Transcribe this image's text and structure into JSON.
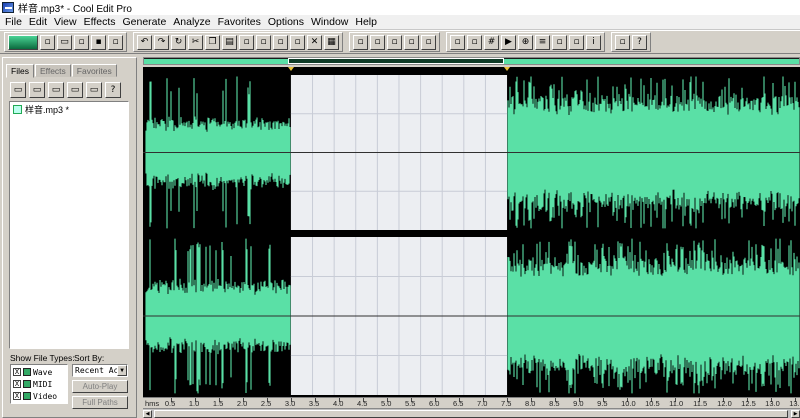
{
  "window": {
    "title": "样音.mp3* - Cool Edit Pro"
  },
  "menu": [
    "File",
    "Edit",
    "View",
    "Effects",
    "Generate",
    "Analyze",
    "Favorites",
    "Options",
    "Window",
    "Help"
  ],
  "toolbar_groups": [
    [
      "wave-view-icon",
      "new-icon",
      "open-icon",
      "close-icon",
      "save-icon",
      "save-all-icon"
    ],
    [
      "undo-icon",
      "redo-icon",
      "repeat-icon",
      "cut-icon",
      "copy-icon",
      "paste-icon",
      "paste-new-icon",
      "mix-paste-icon",
      "trim-icon",
      "silence-icon",
      "delete-icon",
      "select-all-icon"
    ],
    [
      "invert-icon",
      "filter-icon",
      "spectral-icon",
      "frequency-icon",
      "bank-icon"
    ],
    [
      "display-icon",
      "snap-icon",
      "grid-icon",
      "play-icon",
      "zoom-icon",
      "bars-icon",
      "cues-icon",
      "tracks-icon",
      "info-icon"
    ],
    [
      "favorites-icon",
      "help-icon"
    ]
  ],
  "file_panel": {
    "tabs": [
      "Files",
      "Effects",
      "Favorites"
    ],
    "active_tab": "Files",
    "toolbar_icons": [
      "open-file-icon",
      "close-file-icon",
      "import-icon",
      "edit-icon",
      "cd-icon",
      "help-icon"
    ],
    "files": [
      "样音.mp3 *"
    ],
    "show_file_types_label": "Show File Types:",
    "sort_by_label": "Sort By:",
    "file_types": [
      {
        "label": "Wave",
        "checked": true
      },
      {
        "label": "MIDI",
        "checked": true
      },
      {
        "label": "Video",
        "checked": true
      }
    ],
    "sort_value": "Recent Ac",
    "auto_play_label": "Auto-Play",
    "full_paths_label": "Full Paths"
  },
  "colors": {
    "waveform": "#5ae0a6",
    "background": "#000000",
    "selection": "#eceef2",
    "selection_grid": "#c8ccd6",
    "center_line": "#303030"
  },
  "selection": {
    "start_seconds": 3.0,
    "end_seconds": 7.5
  },
  "view": {
    "start_seconds": -0.08,
    "end_seconds": 13.6
  },
  "ruler": {
    "unit": "hms",
    "labels": [
      "0.5",
      "1.0",
      "1.5",
      "2.0",
      "2.5",
      "3.0",
      "3.5",
      "4.0",
      "4.5",
      "5.0",
      "5.5",
      "6.0",
      "6.5",
      "7.0",
      "7.5",
      "8.0",
      "8.5",
      "9.0",
      "9.5",
      "10.0",
      "10.5",
      "11.0",
      "11.5",
      "12.0",
      "12.5",
      "13.0",
      "13.5"
    ]
  },
  "channels": [
    "left",
    "right"
  ],
  "overview": {
    "visible_start": 0.22,
    "visible_end": 0.55
  }
}
